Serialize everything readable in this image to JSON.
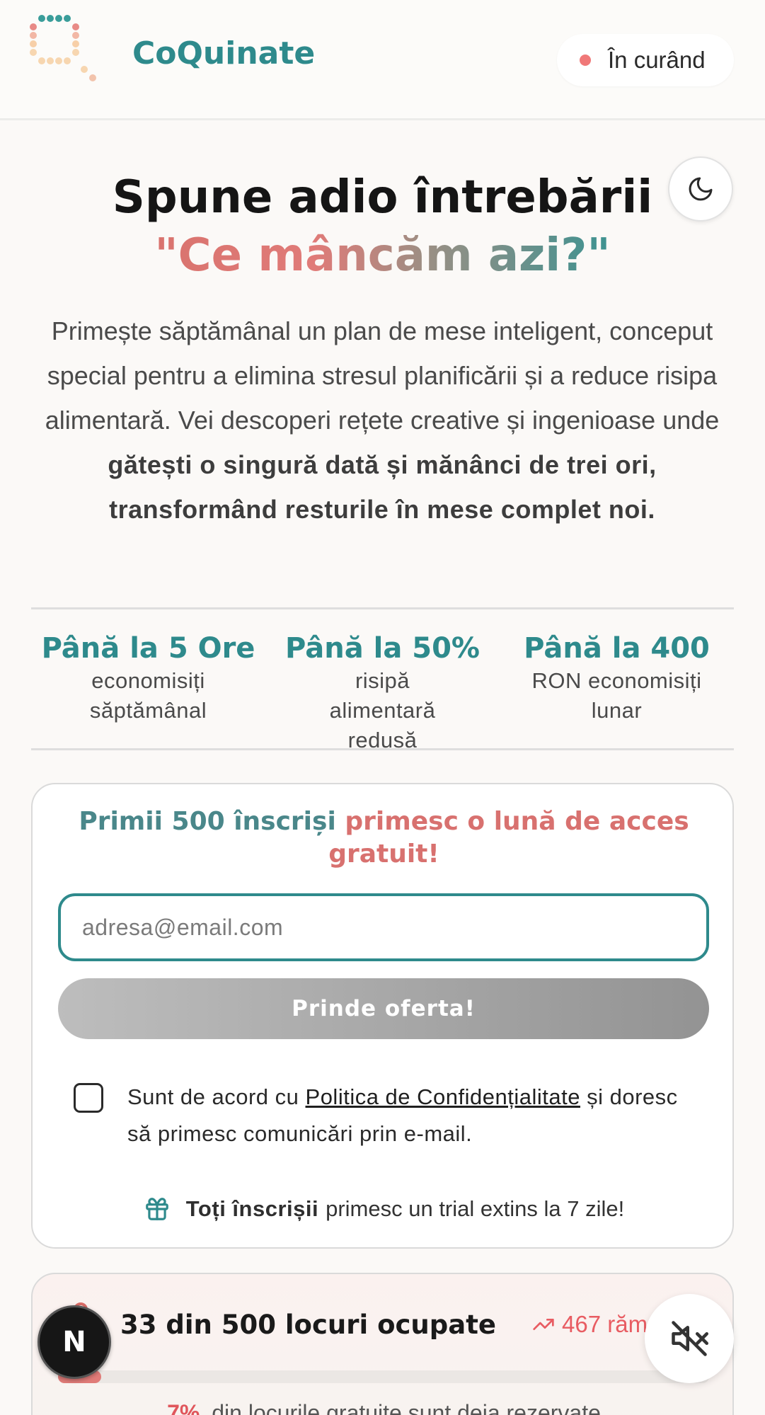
{
  "header": {
    "brand": "CoQuinate",
    "status": "În curând",
    "status_color": "#f07878",
    "brand_color": "#2e8a8c"
  },
  "hero": {
    "title": "Spune adio întrebării",
    "subtitle": "\"Ce mâncăm azi?\"",
    "description": "Primește săptămânal un plan de mese inteligent, conceput special pentru a elimina stresul planificării și a reduce risipa alimentară. Vei descoperi rețete creative și ingenioase unde",
    "description_bold": "gătești o singură dată și mănânci de trei ori, transformând resturile în mese complet noi."
  },
  "stats": [
    {
      "value": "Până la 5 Ore",
      "label": "economisiți săptămânal"
    },
    {
      "value": "Până la 50%",
      "label": "risipă alimentară redusă"
    },
    {
      "value": "Până la 400",
      "label": "RON economisiți lunar"
    }
  ],
  "signup": {
    "offer_part1": "Primii 500 înscriși",
    "offer_part2": "primesc o lună de acces gratuit!",
    "email_placeholder": "adresa@email.com",
    "email_value": "",
    "cta_label": "Prinde oferta!",
    "consent_before": "Sunt de acord cu",
    "consent_link": "Politica de Confidențialitate",
    "consent_after": "și doresc să primesc comunicări prin e-mail.",
    "consent_checked": false,
    "trial_bold": "Toți înscrișii",
    "trial_text": "primesc un trial extins la 7 zile!",
    "gift_icon": "gift-icon"
  },
  "progress": {
    "title": "33 din 500 locuri ocupate",
    "remaining": "467 rămase",
    "percent_label": "7%",
    "note": "din locurile gratuite sunt deja rezervate",
    "filled": 33,
    "total": 500
  },
  "floating": {
    "nav_badge": "N",
    "mute_icon": "volume-mute-icon"
  },
  "colors": {
    "teal": "#2e8a8c",
    "coral": "#e07b78",
    "red": "#e85c62"
  }
}
